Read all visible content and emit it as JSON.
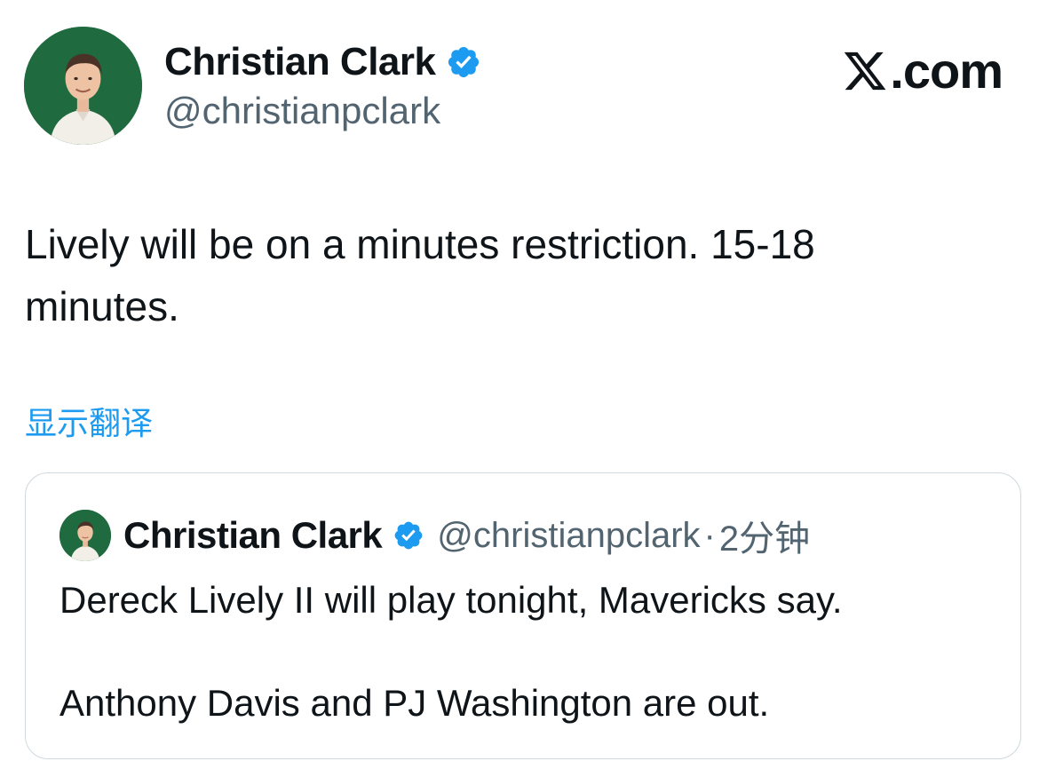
{
  "author": {
    "display_name": "Christian Clark",
    "handle": "@christianpclark",
    "verified": true
  },
  "site_brand": ".com",
  "site_icon": "x-logo-icon",
  "tweet": {
    "text_line1": "Lively will be on a minutes restriction. 15-18",
    "text_line2": "minutes."
  },
  "translate_link": "显示翻译",
  "quoted_tweet": {
    "display_name": "Christian Clark",
    "handle": "@christianpclark",
    "separator": "·",
    "time": "2分钟",
    "line1": "Dereck Lively II will play tonight, Mavericks say.",
    "line2": "Anthony Davis and PJ Washington are out."
  },
  "colors": {
    "verified": "#1d9bf0",
    "link": "#1d9bf0",
    "secondary_text": "#536471",
    "avatar_bg": "#1f6b3f"
  }
}
